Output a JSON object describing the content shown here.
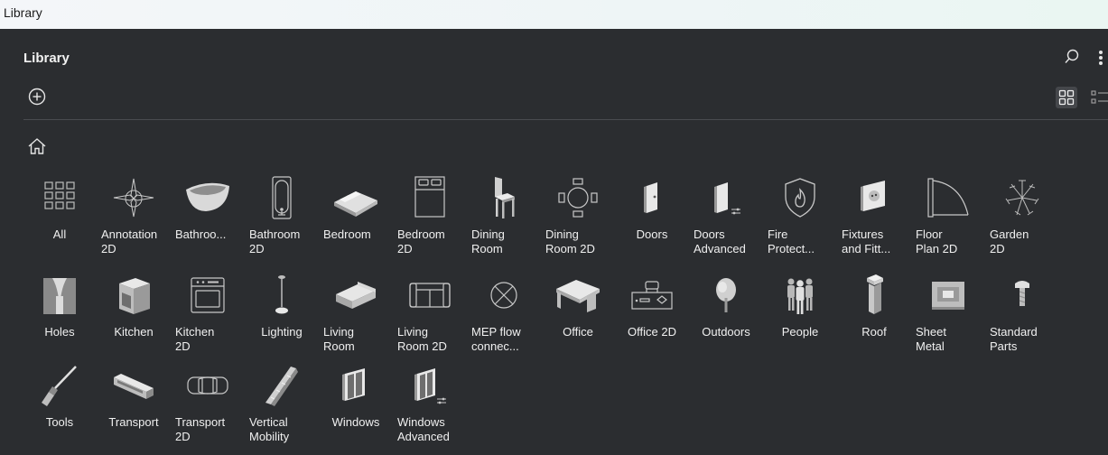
{
  "window": {
    "title": "Library"
  },
  "header": {
    "title": "Library"
  },
  "icons": {
    "search": "search-icon",
    "more": "more-vertical-icon",
    "add": "add-circle-icon",
    "grid_view": "grid-view-icon",
    "list_view": "list-view-icon",
    "home": "home-icon"
  },
  "categories": [
    {
      "label": "All",
      "icon": "all-grid-icon"
    },
    {
      "label": "Annotation\n2D",
      "icon": "compass-rose-icon"
    },
    {
      "label": "Bathroo...",
      "icon": "bathtub-icon"
    },
    {
      "label": "Bathroom\n2D",
      "icon": "bathtub-2d-icon"
    },
    {
      "label": "Bedroom",
      "icon": "bed-icon"
    },
    {
      "label": "Bedroom\n2D",
      "icon": "bed-2d-icon"
    },
    {
      "label": "Dining\nRoom",
      "icon": "chair-icon"
    },
    {
      "label": "Dining\nRoom 2D",
      "icon": "dining-table-2d-icon"
    },
    {
      "label": "Doors",
      "icon": "door-icon"
    },
    {
      "label": "Doors\nAdvanced",
      "icon": "door-advanced-icon"
    },
    {
      "label": "Fire\nProtect...",
      "icon": "fire-shield-icon"
    },
    {
      "label": "Fixtures\nand Fitt...",
      "icon": "socket-icon"
    },
    {
      "label": "Floor\nPlan 2D",
      "icon": "door-swing-2d-icon"
    },
    {
      "label": "Garden\n2D",
      "icon": "tree-2d-icon"
    },
    {
      "label": "Holes",
      "icon": "hole-icon"
    },
    {
      "label": "Kitchen",
      "icon": "oven-icon"
    },
    {
      "label": "Kitchen\n2D",
      "icon": "oven-2d-icon"
    },
    {
      "label": "Lighting",
      "icon": "lamp-icon"
    },
    {
      "label": "Living\nRoom",
      "icon": "sofa-icon"
    },
    {
      "label": "Living\nRoom 2D",
      "icon": "sofa-2d-icon"
    },
    {
      "label": "MEP flow\nconnec...",
      "icon": "mep-connector-icon"
    },
    {
      "label": "Office",
      "icon": "desk-icon"
    },
    {
      "label": "Office 2D",
      "icon": "desk-2d-icon"
    },
    {
      "label": "Outdoors",
      "icon": "outdoor-tree-icon"
    },
    {
      "label": "People",
      "icon": "people-icon"
    },
    {
      "label": "Roof",
      "icon": "chimney-icon"
    },
    {
      "label": "Sheet\nMetal",
      "icon": "sheet-metal-icon"
    },
    {
      "label": "Standard\nParts",
      "icon": "screw-icon"
    },
    {
      "label": "Tools",
      "icon": "screwdriver-icon"
    },
    {
      "label": "Transport",
      "icon": "bus-icon"
    },
    {
      "label": "Transport\n2D",
      "icon": "car-2d-icon"
    },
    {
      "label": "Vertical\nMobility",
      "icon": "escalator-icon"
    },
    {
      "label": "Windows",
      "icon": "window-icon"
    },
    {
      "label": "Windows\nAdvanced",
      "icon": "window-advanced-icon"
    }
  ]
}
